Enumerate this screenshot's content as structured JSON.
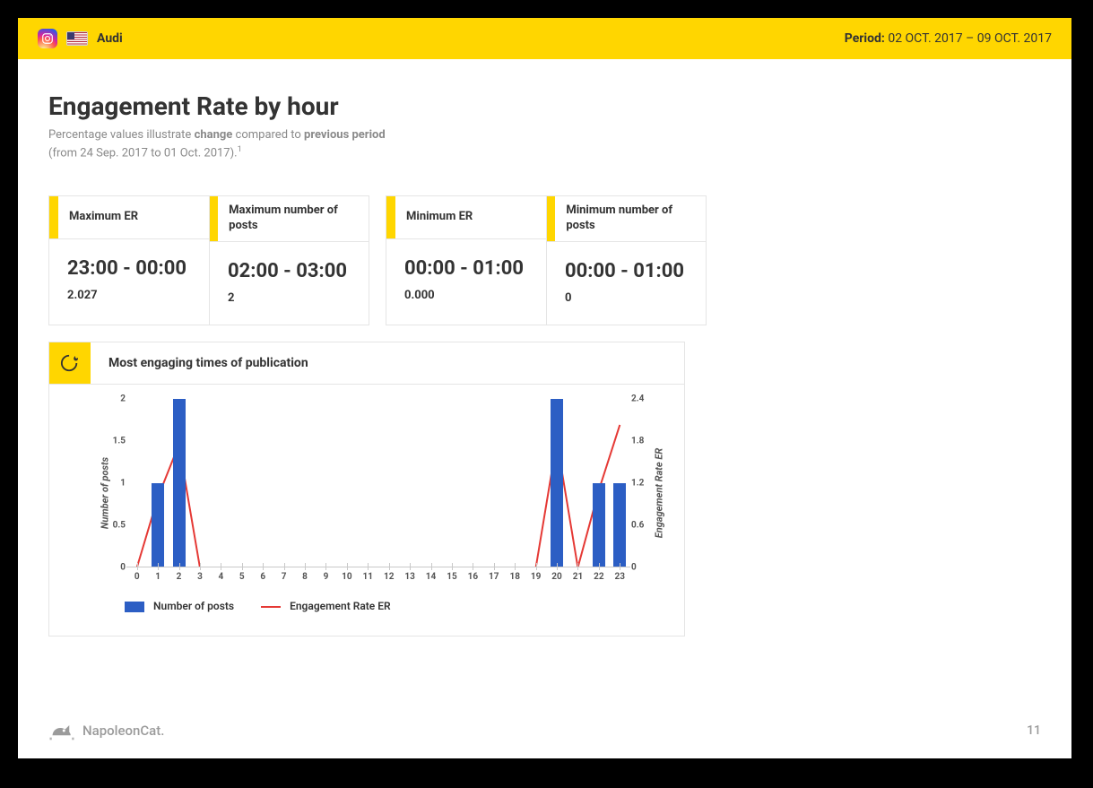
{
  "header": {
    "brand": "Audi",
    "period_label": "Period:",
    "period_value": "02 OCT. 2017 – 09 OCT. 2017"
  },
  "page": {
    "title": "Engagement Rate by hour",
    "subtitle_pre": "Percentage values illustrate ",
    "subtitle_b1": "change",
    "subtitle_mid": " compared to ",
    "subtitle_b2": "previous period",
    "subtitle_line2_pre": "(from 24 Sep. 2017 to 01 Oct. 2017).",
    "subtitle_sup": "1"
  },
  "cards": {
    "max_er": {
      "label": "Maximum ER",
      "big": "23:00 - 00:00",
      "small": "2.027"
    },
    "max_posts": {
      "label": "Maximum number of posts",
      "big": "02:00 - 03:00",
      "small": "2"
    },
    "min_er": {
      "label": "Minimum ER",
      "big": "00:00 - 01:00",
      "small": "0.000"
    },
    "min_posts": {
      "label": "Minimum number of posts",
      "big": "00:00 - 01:00",
      "small": "0"
    }
  },
  "chart_panel": {
    "title": "Most engaging times of publication",
    "legend_posts": "Number of posts",
    "legend_er": "Engagement Rate ER",
    "ylabel_left": "Number of posts",
    "ylabel_right": "Engagement Rate ER"
  },
  "chart_data": {
    "type": "bar",
    "categories": [
      0,
      1,
      2,
      3,
      4,
      5,
      6,
      7,
      8,
      9,
      10,
      11,
      12,
      13,
      14,
      15,
      16,
      17,
      18,
      19,
      20,
      21,
      22,
      23
    ],
    "series": [
      {
        "name": "Number of posts",
        "axis": "left",
        "values": [
          0,
          1,
          2,
          0,
          0,
          0,
          0,
          0,
          0,
          0,
          0,
          0,
          0,
          0,
          0,
          0,
          0,
          0,
          0,
          0,
          2,
          0,
          1,
          1
        ]
      },
      {
        "name": "Engagement Rate ER",
        "axis": "right",
        "values": [
          0,
          1.0,
          1.75,
          0,
          0,
          0,
          0,
          0,
          0,
          0,
          0,
          0,
          0,
          0,
          0,
          0,
          0,
          0,
          0,
          0,
          1.8,
          0,
          1.1,
          2.03
        ]
      }
    ],
    "xlabel": "",
    "ylabel_left": "Number of posts",
    "ylabel_right": "Engagement Rate ER",
    "ylim_left": [
      0,
      2
    ],
    "yticks_left": [
      0,
      0.5,
      1,
      1.5,
      2
    ],
    "ylim_right": [
      0,
      2.4
    ],
    "yticks_right": [
      0,
      0.6,
      1.2,
      1.8,
      2.4
    ],
    "title": "Most engaging times of publication"
  },
  "footer": {
    "brand": "NapoleonCat.",
    "page_number": "11"
  }
}
